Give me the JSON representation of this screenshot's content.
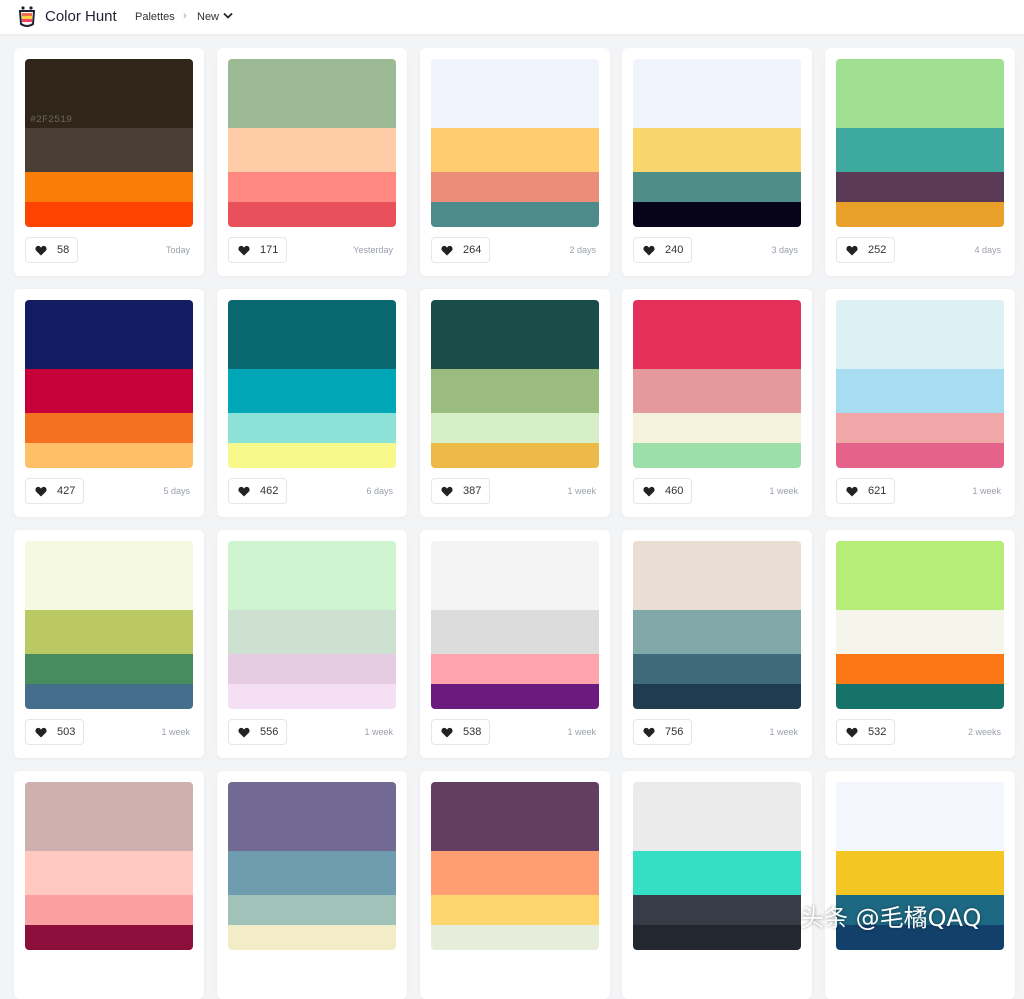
{
  "header": {
    "brand": "Color Hunt",
    "breadcrumb": [
      "Palettes",
      "New"
    ],
    "separator": "›"
  },
  "cards": [
    {
      "colors": [
        "#2F2519",
        "#4A3F35",
        "#FA7D09",
        "#FF4301"
      ],
      "hex_label": "#2F2519",
      "likes": "58",
      "age": "Today"
    },
    {
      "colors": [
        "#9DBA97",
        "#FFCCA8",
        "#FF8882",
        "#E8505B"
      ],
      "likes": "171",
      "age": "Yesterday"
    },
    {
      "colors": [
        "#F1F4FC",
        "#FFCC70",
        "#EA8E7A",
        "#4C8B89"
      ],
      "likes": "264",
      "age": "2 days"
    },
    {
      "colors": [
        "#F1F4FC",
        "#F9D56E",
        "#4E8D88",
        "#070318"
      ],
      "likes": "240",
      "age": "3 days"
    },
    {
      "colors": [
        "#A0DE92",
        "#3EA99F",
        "#5B3A55",
        "#E8A02A"
      ],
      "likes": "252",
      "age": "4 days"
    },
    {
      "colors": [
        "#131B62",
        "#C70039",
        "#F37121",
        "#FFBF66"
      ],
      "likes": "427",
      "age": "5 days"
    },
    {
      "colors": [
        "#0A6871",
        "#00A8B7",
        "#8DE2D8",
        "#F7F98A"
      ],
      "likes": "462",
      "age": "6 days"
    },
    {
      "colors": [
        "#1B4D48",
        "#9ABD7F",
        "#D6EFC7",
        "#EDBA4A"
      ],
      "likes": "387",
      "age": "1 week"
    },
    {
      "colors": [
        "#E5305C",
        "#E49A9D",
        "#F5F3DC",
        "#9DDFAB"
      ],
      "likes": "460",
      "age": "1 week"
    },
    {
      "colors": [
        "#DDF1F5",
        "#A8DCF0",
        "#F1A6A7",
        "#E5638A"
      ],
      "likes": "621",
      "age": "1 week"
    },
    {
      "colors": [
        "#F4F9E0",
        "#BBC964",
        "#468C5D",
        "#456E8C"
      ],
      "likes": "503",
      "age": "1 week"
    },
    {
      "colors": [
        "#CEF5CF",
        "#CEE1D0",
        "#E5CCE2",
        "#F5DFF5"
      ],
      "likes": "556",
      "age": "1 week"
    },
    {
      "colors": [
        "#F3F3F3",
        "#DCDCDC",
        "#FFA3AF",
        "#6B1B7D"
      ],
      "likes": "538",
      "age": "1 week"
    },
    {
      "colors": [
        "#E8DED3",
        "#80A8A9",
        "#3E6A79",
        "#1F3D4E"
      ],
      "likes": "756",
      "age": "1 week"
    },
    {
      "colors": [
        "#B6EC78",
        "#F5F5EB",
        "#FC7716",
        "#16736A"
      ],
      "likes": "532",
      "age": "2 weeks"
    },
    {
      "colors": [
        "#CFB0AE",
        "#FFC8C1",
        "#FBA0A0",
        "#8C0E3A"
      ],
      "likes": "",
      "age": ""
    },
    {
      "colors": [
        "#736A93",
        "#6F9DAF",
        "#A0C2B9",
        "#F3EDC7"
      ],
      "likes": "",
      "age": ""
    },
    {
      "colors": [
        "#643E61",
        "#FE9E71",
        "#FDD56F",
        "#E7EDDB"
      ],
      "likes": "",
      "age": ""
    },
    {
      "colors": [
        "#EBEBEB",
        "#35DFC4",
        "#363D47",
        "#232730"
      ],
      "likes": "",
      "age": ""
    },
    {
      "colors": [
        "#F3F6FD",
        "#F3C623",
        "#1D6983",
        "#12406B"
      ],
      "likes": "",
      "age": ""
    }
  ],
  "watermark": "头条 @毛橘QAQ"
}
